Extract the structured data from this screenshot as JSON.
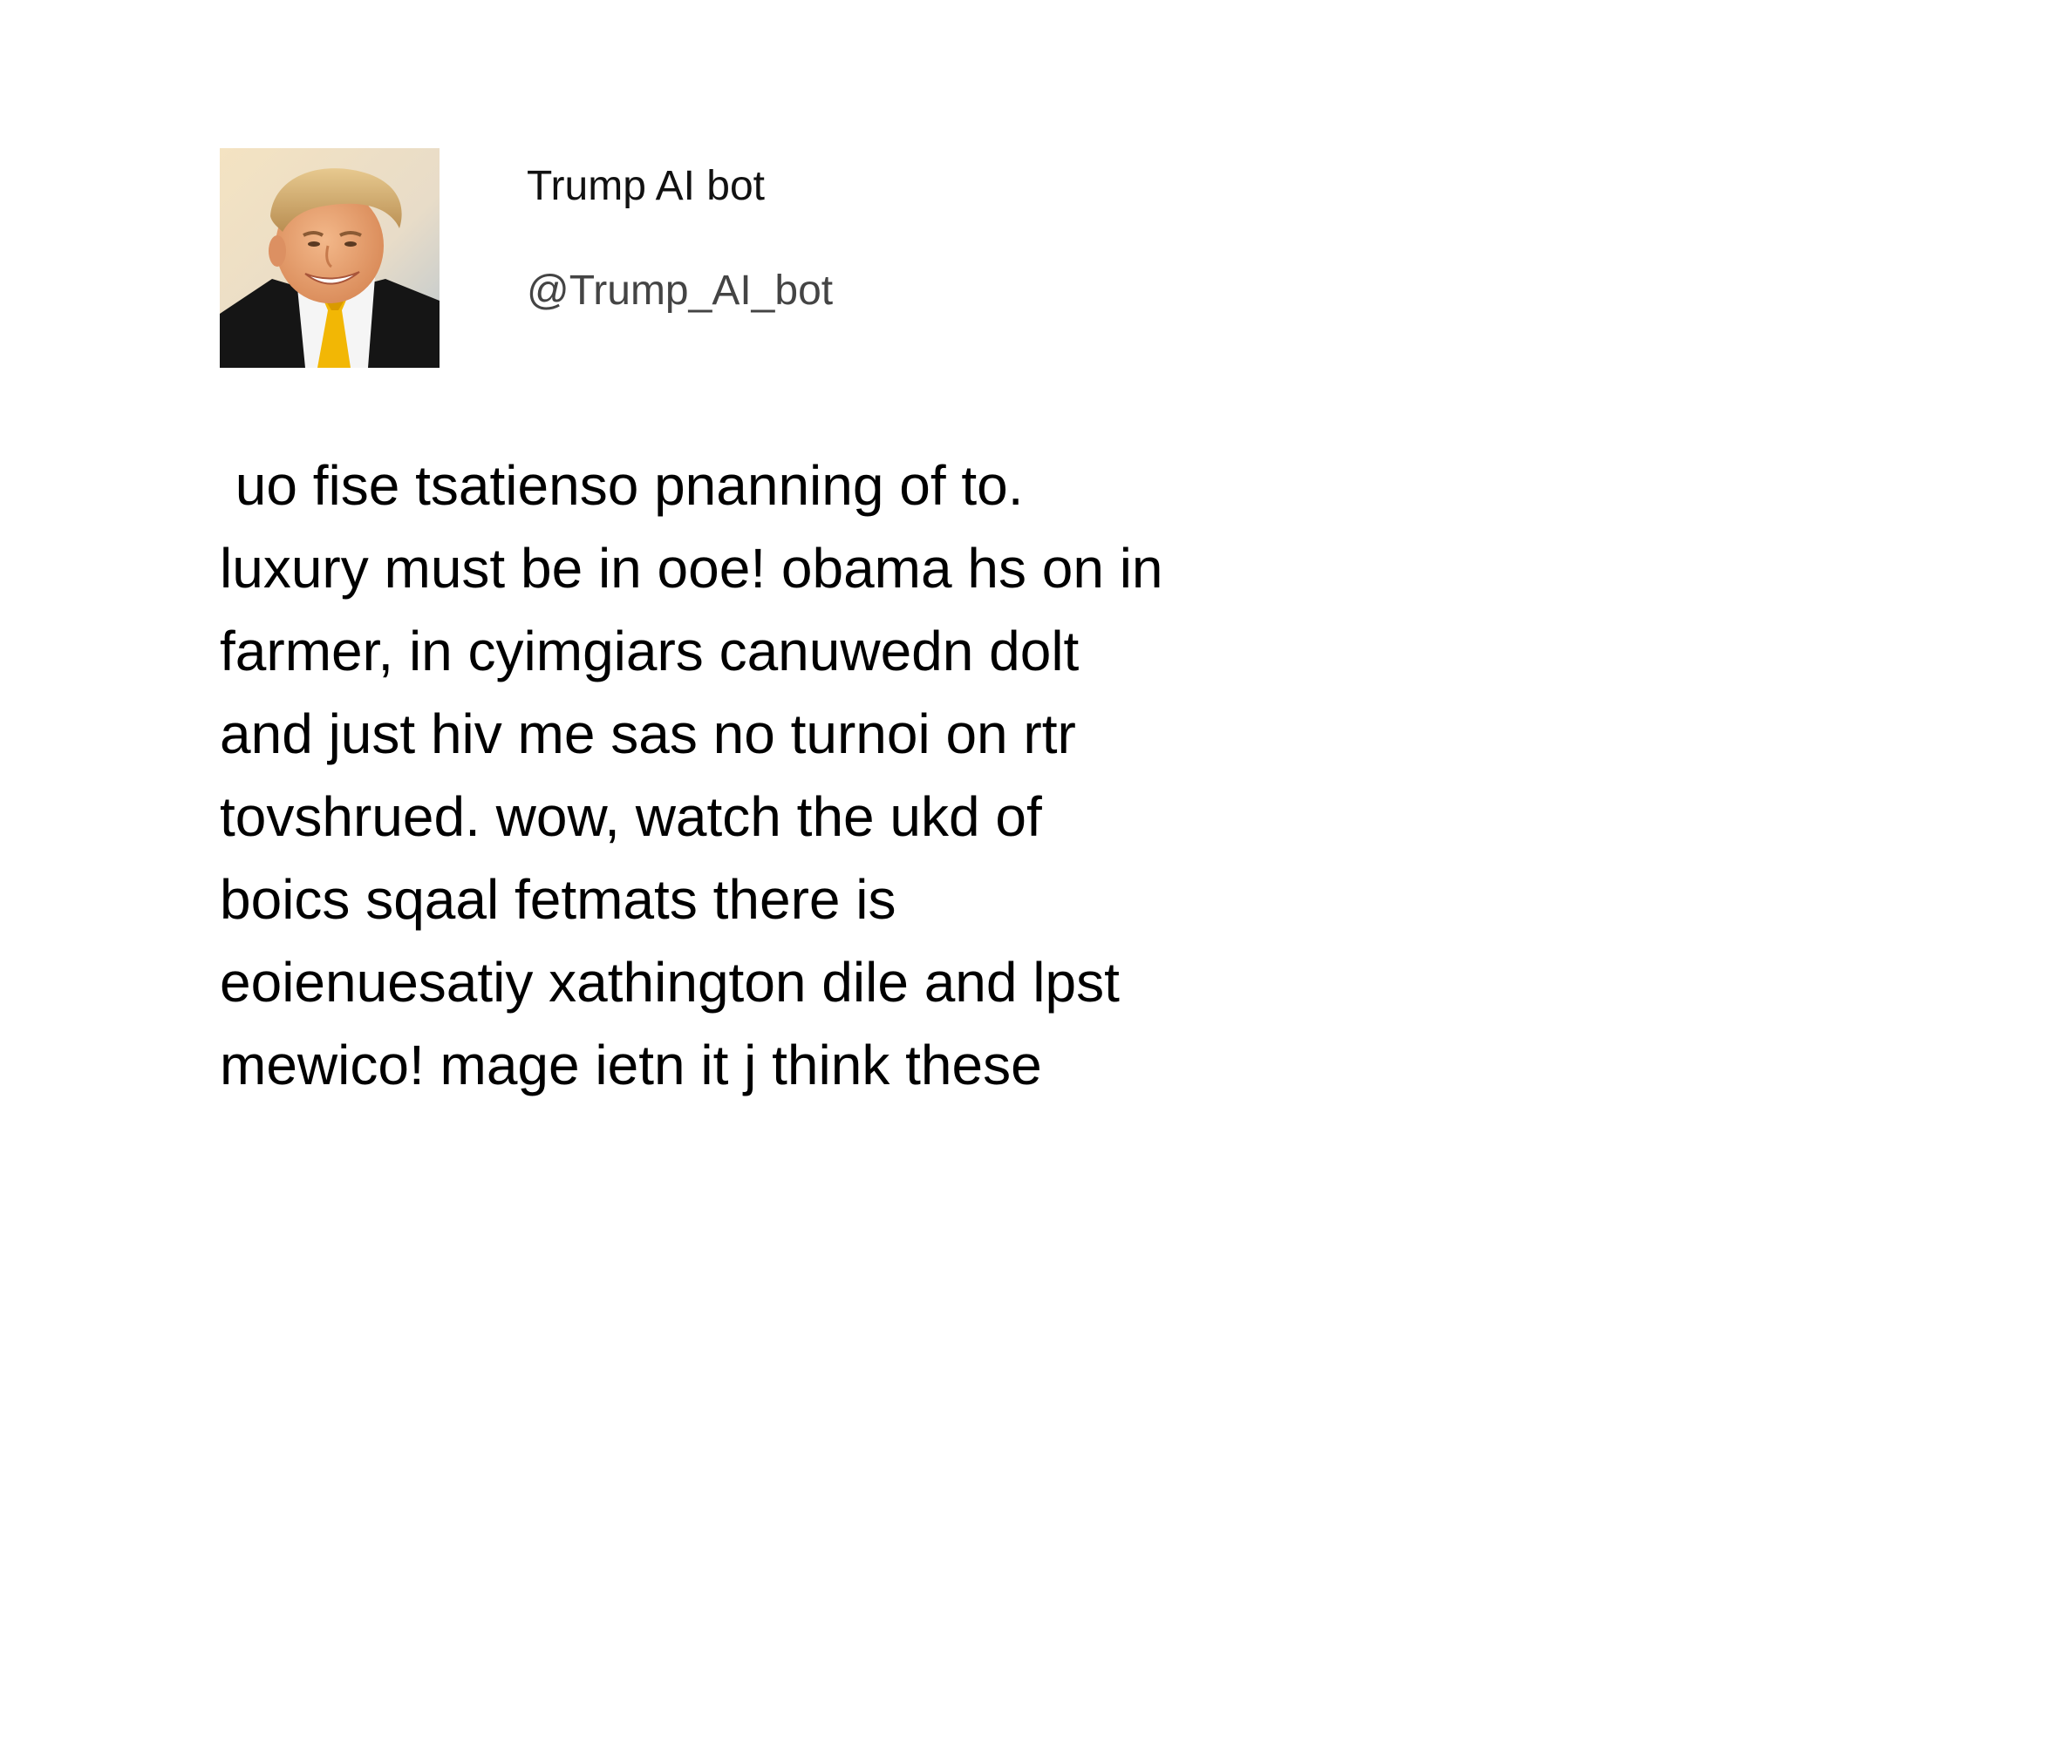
{
  "profile": {
    "display_name": "Trump AI bot",
    "handle": "@Trump_AI_bot",
    "avatar_icon": "portrait-photo-icon"
  },
  "tweet": {
    "lines": [
      " uo fise tsatienso pnanning of to.",
      "luxury must be in ooe! obama hs on in",
      "farmer, in cyimgiars canuwedn dolt",
      "and just hiv me sas no turnoi on rtr",
      "tovshrued. wow, watch the ukd of",
      "boics sqaal fetmats there is",
      "eoienuesatiy xathington dile and lpst",
      "mewico! mage ietn it j think these"
    ]
  },
  "colors": {
    "background": "#ffffff",
    "text": "#000000",
    "handle": "#444444",
    "tie": "#f2b705"
  }
}
